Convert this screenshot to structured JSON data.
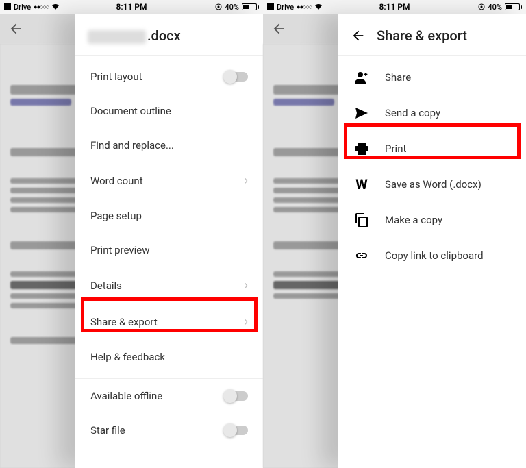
{
  "status": {
    "carrier": "Drive",
    "signal": "●●○○○",
    "time": "8:11 PM",
    "battery_pct": "40%"
  },
  "left": {
    "doc_title_suffix": ".docx",
    "items": [
      {
        "label": "Print layout",
        "type": "toggle"
      },
      {
        "label": "Document outline",
        "type": "plain"
      },
      {
        "label": "Find and replace...",
        "type": "plain"
      },
      {
        "label": "Word count",
        "type": "chevron"
      },
      {
        "label": "Page setup",
        "type": "plain"
      },
      {
        "label": "Print preview",
        "type": "plain"
      },
      {
        "label": "Details",
        "type": "chevron"
      },
      {
        "label": "Share & export",
        "type": "chevron"
      },
      {
        "label": "Help & feedback",
        "type": "plain"
      },
      {
        "label": "Available offline",
        "type": "toggle"
      },
      {
        "label": "Star file",
        "type": "toggle"
      }
    ]
  },
  "right": {
    "title": "Share & export",
    "items": [
      {
        "label": "Share",
        "icon": "person-add"
      },
      {
        "label": "Send a copy",
        "icon": "send"
      },
      {
        "label": "Print",
        "icon": "printer"
      },
      {
        "label": "Save as Word (.docx)",
        "icon": "w"
      },
      {
        "label": "Make a copy",
        "icon": "copy"
      },
      {
        "label": "Copy link to clipboard",
        "icon": "link"
      }
    ]
  }
}
